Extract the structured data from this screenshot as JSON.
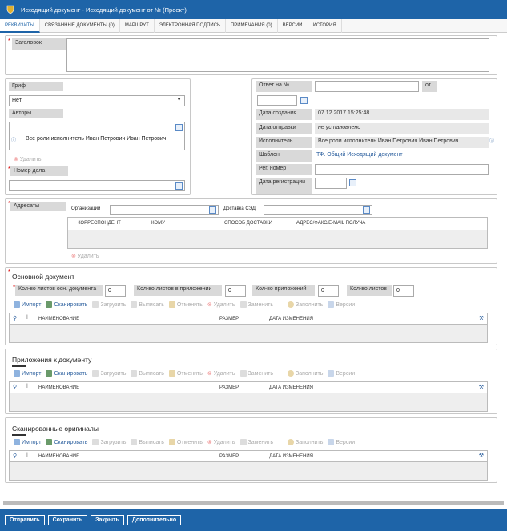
{
  "window": {
    "title": "Исходящий документ - Исходящий документ от № (Проект)"
  },
  "tabs": [
    {
      "label": "Реквизиты"
    },
    {
      "label": "Связанные документы (0)"
    },
    {
      "label": "Маршрут"
    },
    {
      "label": "Электронная подпись"
    },
    {
      "label": "Примечания (0)"
    },
    {
      "label": "Версии"
    },
    {
      "label": "История"
    }
  ],
  "header_field": {
    "label": "Заголовок",
    "value": ""
  },
  "left": {
    "grif_label": "Гриф",
    "grif_value": "Нет",
    "authors_label": "Авторы",
    "author_entry": "Все роли исполнитель Иван Петрович Иван Петрович",
    "delete_label": "Удалить",
    "case_label": "Номер дела",
    "case_value": ""
  },
  "right": {
    "reply_label": "Ответ на №",
    "from_label": "от",
    "created_label": "Дата создания",
    "created_value": "07.12.2017 15:25:48",
    "sent_label": "Дата отправки",
    "sent_value": "не установлено",
    "executor_label": "Исполнитель",
    "executor_value": "Все роли исполнитель Иван Петрович Иван Петрович",
    "template_label": "Шаблон",
    "template_value": "ТФ. Общий Исходящий документ",
    "reg_number_label": "Рег. номер",
    "reg_date_label": "Дата регистрации"
  },
  "addressees": {
    "label": "Адресаты",
    "org_label": "Организации",
    "sed_label": "Доставка СЭД",
    "columns": [
      "Корреспондент",
      "Кому",
      "Способ доставки",
      "Адрес/факс/E-mail получа"
    ],
    "delete_label": "Удалить"
  },
  "main_doc": {
    "title": "Основной документ",
    "sheets_main_label": "Кол-во листов осн. документа",
    "sheets_main_value": "0",
    "sheets_attach_label": "Кол-во листов в приложении",
    "sheets_attach_value": "0",
    "attach_count_label": "Кол-во приложений",
    "attach_count_value": "0",
    "sheets_label": "Кол-во листов",
    "sheets_value": "0"
  },
  "toolbar": {
    "import": "Импорт",
    "scan": "Сканировать",
    "upload": "Загрузить",
    "checkout": "Выписать",
    "cancel": "Отменить",
    "delete": "Удалить",
    "replace": "Заменить",
    "fill": "Заполнить",
    "versions": "Версии"
  },
  "file_columns": {
    "name": "Наименование",
    "size": "Размер",
    "date": "Дата изменения"
  },
  "attachments": {
    "title": "Приложения к документу"
  },
  "scans": {
    "title": "Сканированные оригиналы"
  },
  "bottom": {
    "send": "Отправить",
    "save": "Сохранить",
    "close": "Закрыть",
    "more": "Дополнительно"
  }
}
